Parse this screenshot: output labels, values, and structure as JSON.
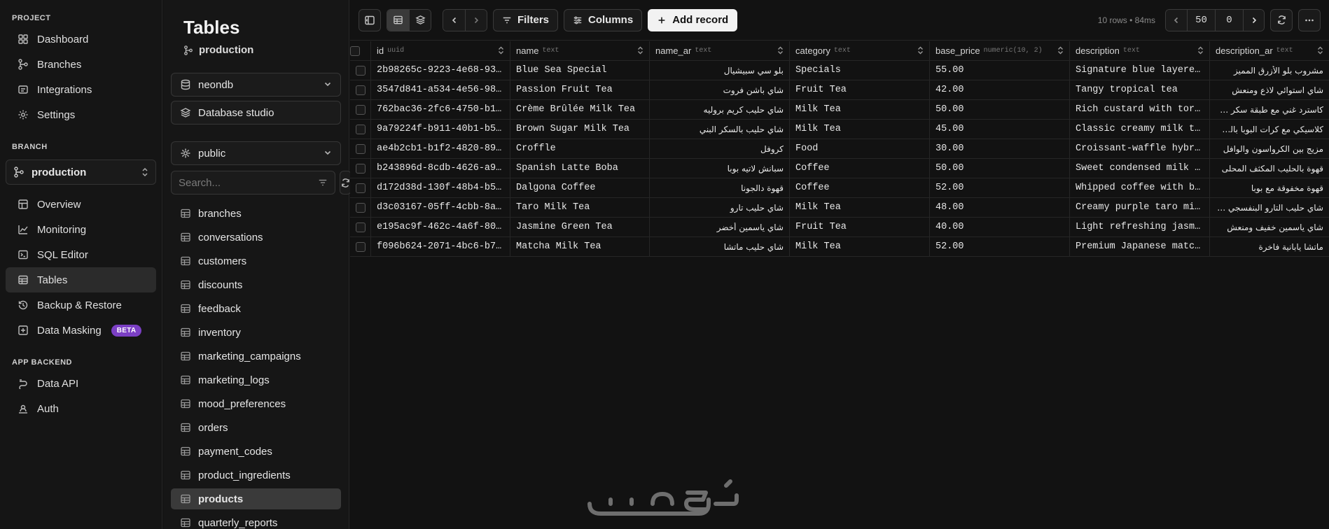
{
  "nav": {
    "sections": [
      {
        "title": "PROJECT",
        "items": [
          {
            "label": "Dashboard",
            "icon": "grid-icon"
          },
          {
            "label": "Branches",
            "icon": "branch-icon"
          },
          {
            "label": "Integrations",
            "icon": "integrations-icon"
          },
          {
            "label": "Settings",
            "icon": "gear-icon"
          }
        ]
      },
      {
        "title": "BRANCH",
        "items": [
          {
            "label": "Overview",
            "icon": "overview-icon"
          },
          {
            "label": "Monitoring",
            "icon": "chart-icon"
          },
          {
            "label": "SQL Editor",
            "icon": "terminal-icon"
          },
          {
            "label": "Tables",
            "icon": "table-icon",
            "active": true
          },
          {
            "label": "Backup & Restore",
            "icon": "history-icon"
          },
          {
            "label": "Data Masking",
            "icon": "mask-icon",
            "badge": "BETA"
          }
        ]
      },
      {
        "title": "APP BACKEND",
        "items": [
          {
            "label": "Data API",
            "icon": "api-icon"
          },
          {
            "label": "Auth",
            "icon": "auth-icon"
          }
        ]
      }
    ],
    "branch_select": "production"
  },
  "panel": {
    "title": "Tables",
    "branch": "production",
    "database": "neondb",
    "studio": "Database studio",
    "schema": "public",
    "search_placeholder": "Search...",
    "tables": [
      "branches",
      "conversations",
      "customers",
      "discounts",
      "feedback",
      "inventory",
      "marketing_campaigns",
      "marketing_logs",
      "mood_preferences",
      "orders",
      "payment_codes",
      "product_ingredients",
      "products",
      "quarterly_reports"
    ],
    "active_table": "products"
  },
  "toolbar": {
    "filters": "Filters",
    "columns": "Columns",
    "add_record": "Add record",
    "meta": "10 rows • 84ms",
    "limit": "50",
    "offset": "0"
  },
  "grid": {
    "columns": [
      {
        "key": "id",
        "name": "id",
        "type": "uuid"
      },
      {
        "key": "name",
        "name": "name",
        "type": "text"
      },
      {
        "key": "name_ar",
        "name": "name_ar",
        "type": "text"
      },
      {
        "key": "category",
        "name": "category",
        "type": "text"
      },
      {
        "key": "base_price",
        "name": "base_price",
        "type": "numeric(10, 2)"
      },
      {
        "key": "description",
        "name": "description",
        "type": "text"
      },
      {
        "key": "description_ar",
        "name": "description_ar",
        "type": "text"
      }
    ],
    "rows": [
      {
        "id": "2b98265c-9223-4e68-937…",
        "name": "Blue Sea Special",
        "name_ar": "بلو سي سبيشيال",
        "category": "Specials",
        "base_price": "55.00",
        "description": "Signature blue layered…",
        "description_ar": "مشروب بلو الأزرق المميز"
      },
      {
        "id": "3547d841-a534-4e56-988…",
        "name": "Passion Fruit Tea",
        "name_ar": "شاي باشن فروت",
        "category": "Fruit Tea",
        "base_price": "42.00",
        "description": "Tangy tropical tea",
        "description_ar": "شاي استوائي لاذع ومنعش"
      },
      {
        "id": "762bac36-2fc6-4750-b1a…",
        "name": "Crème Brûlée Milk Tea",
        "name_ar": "شاي حليب كريم بروليه",
        "category": "Milk Tea",
        "base_price": "50.00",
        "description": "Rich custard with torc…",
        "description_ar": "كاسترد غني مع طبقة سكر محروق"
      },
      {
        "id": "9a79224f-b911-40b1-b51…",
        "name": "Brown Sugar Milk Tea",
        "name_ar": "شاي حليب بالسكر البني",
        "category": "Milk Tea",
        "base_price": "45.00",
        "description": "Classic creamy milk te…",
        "description_ar": "كلاسيكي مع كرات البوبا بالسكر البني"
      },
      {
        "id": "ae4b2cb1-b1f2-4820-892…",
        "name": "Croffle",
        "name_ar": "كروفل",
        "category": "Food",
        "base_price": "30.00",
        "description": "Croissant-waffle hybrid",
        "description_ar": "مزيج بين الكرواسون والوافل"
      },
      {
        "id": "b243896d-8cdb-4626-a9a…",
        "name": "Spanish Latte Boba",
        "name_ar": "سبانش لاتيه بوبا",
        "category": "Coffee",
        "base_price": "50.00",
        "description": "Sweet condensed milk c…",
        "description_ar": "قهوة بالحليب المكثف المحلى"
      },
      {
        "id": "d172d38d-130f-48b4-b57…",
        "name": "Dalgona Coffee",
        "name_ar": "قهوة دالجونا",
        "category": "Coffee",
        "base_price": "52.00",
        "description": "Whipped coffee with bo…",
        "description_ar": "قهوة مخفوقة مع بوبا"
      },
      {
        "id": "d3c03167-05ff-4cbb-8a0…",
        "name": "Taro Milk Tea",
        "name_ar": "شاي حليب تارو",
        "category": "Milk Tea",
        "base_price": "48.00",
        "description": "Creamy purple taro mil…",
        "description_ar": "شاي حليب التارو البنفسجي الكريمي"
      },
      {
        "id": "e195ac9f-462c-4a6f-800…",
        "name": "Jasmine Green Tea",
        "name_ar": "شاي ياسمين أخضر",
        "category": "Fruit Tea",
        "base_price": "40.00",
        "description": "Light refreshing jasmi…",
        "description_ar": "شاي ياسمين خفيف ومنعش"
      },
      {
        "id": "f096b624-2071-4bc6-b7f…",
        "name": "Matcha Milk Tea",
        "name_ar": "شاي حليب ماتشا",
        "category": "Milk Tea",
        "base_price": "52.00",
        "description": "Premium Japanese matcha",
        "description_ar": "ماتشا يابانية فاخرة"
      }
    ]
  },
  "watermark": "خمسات"
}
